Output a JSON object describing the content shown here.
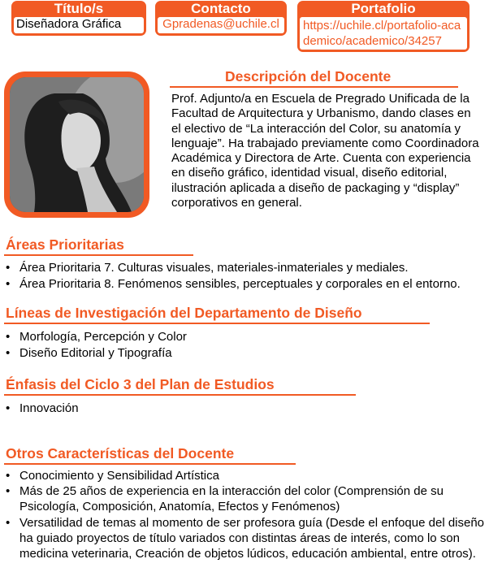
{
  "header": {
    "titulo": {
      "label": "Título/s",
      "value": "Diseñadora Gráfica"
    },
    "contacto": {
      "label": "Contacto",
      "value": "Gpradenas@uchile.cl"
    },
    "portafolio": {
      "label": "Portafolio",
      "value": "https://uchile.cl/portafolio-academico/academico/34257"
    }
  },
  "descripcion": {
    "title": "Descripción del Docente",
    "text": "Prof. Adjunto/a en Escuela de Pregrado Unificada de la Facultad de Arquitectura y Urbanismo, dando clases en el electivo de “La interacción del Color, su anatomía y lenguaje”. Ha trabajado previamente como Coordinadora Académica y Directora de Arte. Cuenta con experiencia en diseño gráfico, identidad visual, diseño editorial, ilustración aplicada a diseño de packaging y “display” corporativos en general."
  },
  "areas": {
    "title": "Áreas Prioritarias",
    "items": [
      "Área Prioritaria 7. Culturas visuales, materiales-inmateriales y mediales.",
      "Área Prioritaria 8. Fenómenos sensibles, perceptuales y corporales en el entorno."
    ]
  },
  "lineas": {
    "title": "Líneas de Investigación del Departamento de Diseño",
    "items": [
      "Morfología, Percepción y Color",
      "Diseño Editorial y Tipografía"
    ]
  },
  "enfasis": {
    "title": "Énfasis del Ciclo 3 del Plan de Estudios",
    "items": [
      "Innovación"
    ]
  },
  "otros": {
    "title": "Otros Características del Docente",
    "items": [
      "Conocimiento y Sensibilidad Artística",
      "Más de 25 años de experiencia en la interacción del color (Comprensión de su Psicología, Composición, Anatomía, Efectos y Fenómenos)",
      "Versatilidad de temas al momento de ser profesora guía (Desde el enfoque del diseño ha guiado proyectos de título variados con distintas áreas de interés, como lo son medicina veterinaria, Creación de objetos lúdicos, educación ambiental, entre otros)."
    ]
  },
  "colors": {
    "accent": "#f15a24"
  }
}
